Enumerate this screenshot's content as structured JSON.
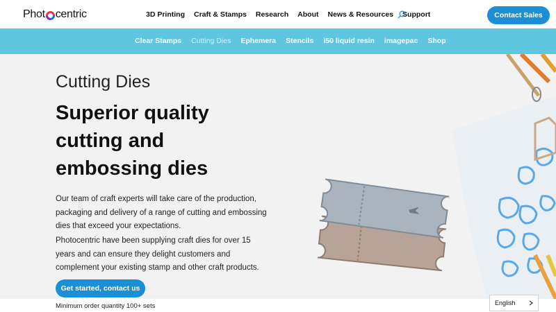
{
  "header": {
    "logo_text_left": "Phot",
    "logo_text_right": "centric",
    "nav": [
      "3D Printing",
      "Craft & Stamps",
      "Research",
      "About",
      "News & Resources",
      "Support"
    ],
    "contact_label": "Contact Sales",
    "search_icon": "search-icon"
  },
  "subnav": {
    "items": [
      "Clear Stamps",
      "Cutting Dies",
      "Ephemera",
      "Stencils",
      "i50 liquid resin",
      "imagepac",
      "Shop"
    ],
    "active": "Cutting Dies"
  },
  "hero": {
    "kicker": "Cutting Dies",
    "headline_line1": "Superior quality",
    "headline_line2": "cutting and",
    "headline_line3": "embossing dies",
    "para1": "Our team of craft experts will take care of the production, packaging and delivery of a range of cutting and embossing dies that exceed your expectations.",
    "para2": "Photocentric have been supplying craft dies for over 15 years and can ensure they delight customers and complement your existing stamp and other craft products.",
    "cta_label": "Get started, contact us",
    "min_order": "Minimum order quantity 100+ sets"
  },
  "language": {
    "selected": "English"
  },
  "colors": {
    "accent_blue": "#1b8fd6",
    "subnav_bg": "#5fc6e0"
  }
}
